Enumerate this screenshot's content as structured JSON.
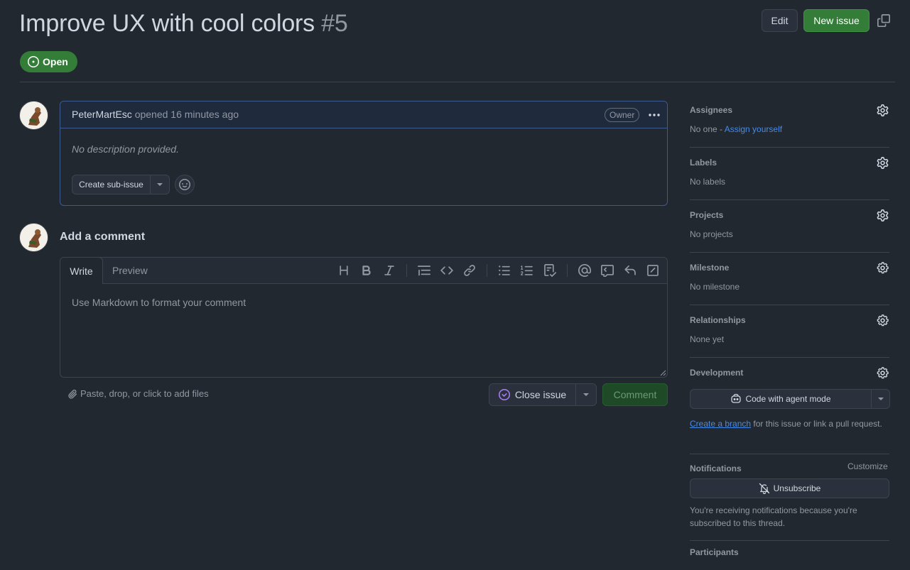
{
  "issue": {
    "title": "Improve UX with cool colors",
    "number": "#5",
    "state": "Open",
    "author": "PeterMartEsc",
    "opened_text": "opened 16 minutes ago",
    "role_badge": "Owner",
    "description": "No description provided."
  },
  "header": {
    "edit_label": "Edit",
    "new_issue_label": "New issue"
  },
  "body": {
    "create_sub_issue_label": "Create sub-issue"
  },
  "comment": {
    "heading": "Add a comment",
    "tab_write": "Write",
    "tab_preview": "Preview",
    "placeholder": "Use Markdown to format your comment",
    "attach_note": "Paste, drop, or click to add files",
    "close_issue_label": "Close issue",
    "comment_label": "Comment",
    "toolbar_icons": [
      "heading-icon",
      "bold-icon",
      "italic-icon",
      "quote-icon",
      "code-icon",
      "link-icon",
      "bulleted-list-icon",
      "numbered-list-icon",
      "task-list-icon",
      "mention-icon",
      "reference-icon",
      "reply-icon",
      "slash-commands-icon"
    ]
  },
  "sidebar": {
    "assignees": {
      "heading": "Assignees",
      "none": "No one - ",
      "assign_link": "Assign yourself"
    },
    "labels": {
      "heading": "Labels",
      "value": "No labels"
    },
    "projects": {
      "heading": "Projects",
      "value": "No projects"
    },
    "milestone": {
      "heading": "Milestone",
      "value": "No milestone"
    },
    "relationships": {
      "heading": "Relationships",
      "value": "None yet"
    },
    "development": {
      "heading": "Development",
      "agent_button": "Code with agent mode",
      "branch_link": "Create a branch",
      "branch_text": " for this issue or link a pull request."
    },
    "notifications": {
      "heading": "Notifications",
      "customize": "Customize",
      "unsubscribe": "Unsubscribe",
      "reason": "You're receiving notifications because you're subscribed to this thread."
    },
    "participants": {
      "heading": "Participants"
    }
  },
  "colors": {
    "background": "#212830",
    "open_green": "#347d39",
    "link_blue": "#478be6",
    "close_purple": "#ab7df8"
  }
}
